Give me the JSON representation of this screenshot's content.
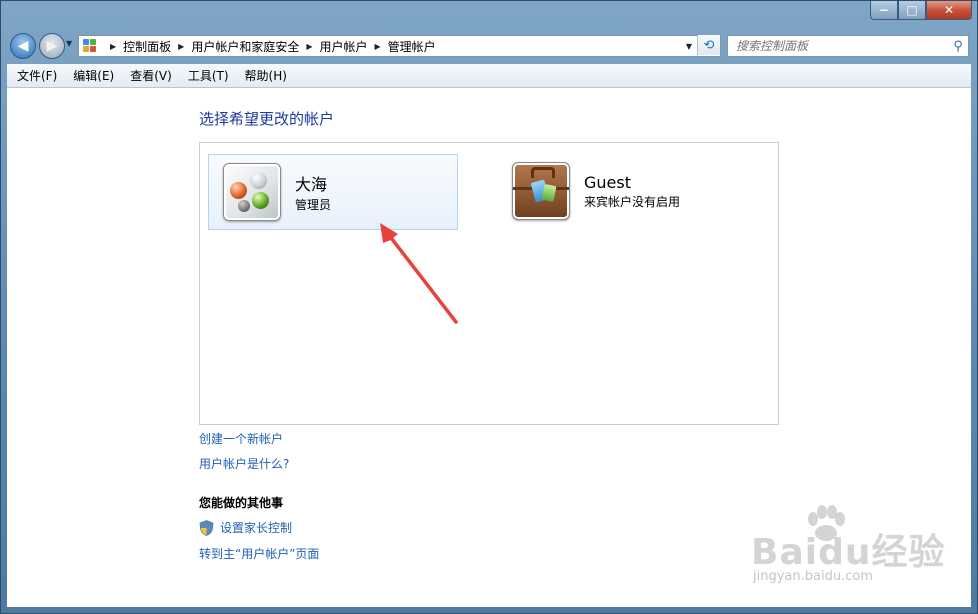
{
  "window": {
    "buttons": {
      "minimize": "−",
      "maximize": "□",
      "close": "✕"
    }
  },
  "address_bar": {
    "breadcrumbs": [
      "控制面板",
      "用户帐户和家庭安全",
      "用户帐户",
      "管理帐户"
    ]
  },
  "search": {
    "placeholder": "搜索控制面板"
  },
  "menu": [
    "文件(F)",
    "编辑(E)",
    "查看(V)",
    "工具(T)",
    "帮助(H)"
  ],
  "main": {
    "title": "选择希望更改的帐户",
    "accounts": [
      {
        "name": "大海",
        "description": "管理员",
        "selected": true
      },
      {
        "name": "Guest",
        "description": "来宾帐户没有启用",
        "selected": false
      }
    ],
    "links": {
      "create_account": "创建一个新帐户",
      "what_is_account": "用户帐户是什么?"
    },
    "other_tasks": {
      "heading": "您能做的其他事",
      "parental_control": "设置家长控制",
      "go_to_main": "转到主“用户帐户”页面"
    }
  },
  "watermark": {
    "brand": "Baidu经验",
    "url": "jingyan.baidu.com"
  },
  "colors": {
    "link": "#1f5fb8",
    "title": "#1e3aa3",
    "annotation_arrow": "#e8423b"
  }
}
